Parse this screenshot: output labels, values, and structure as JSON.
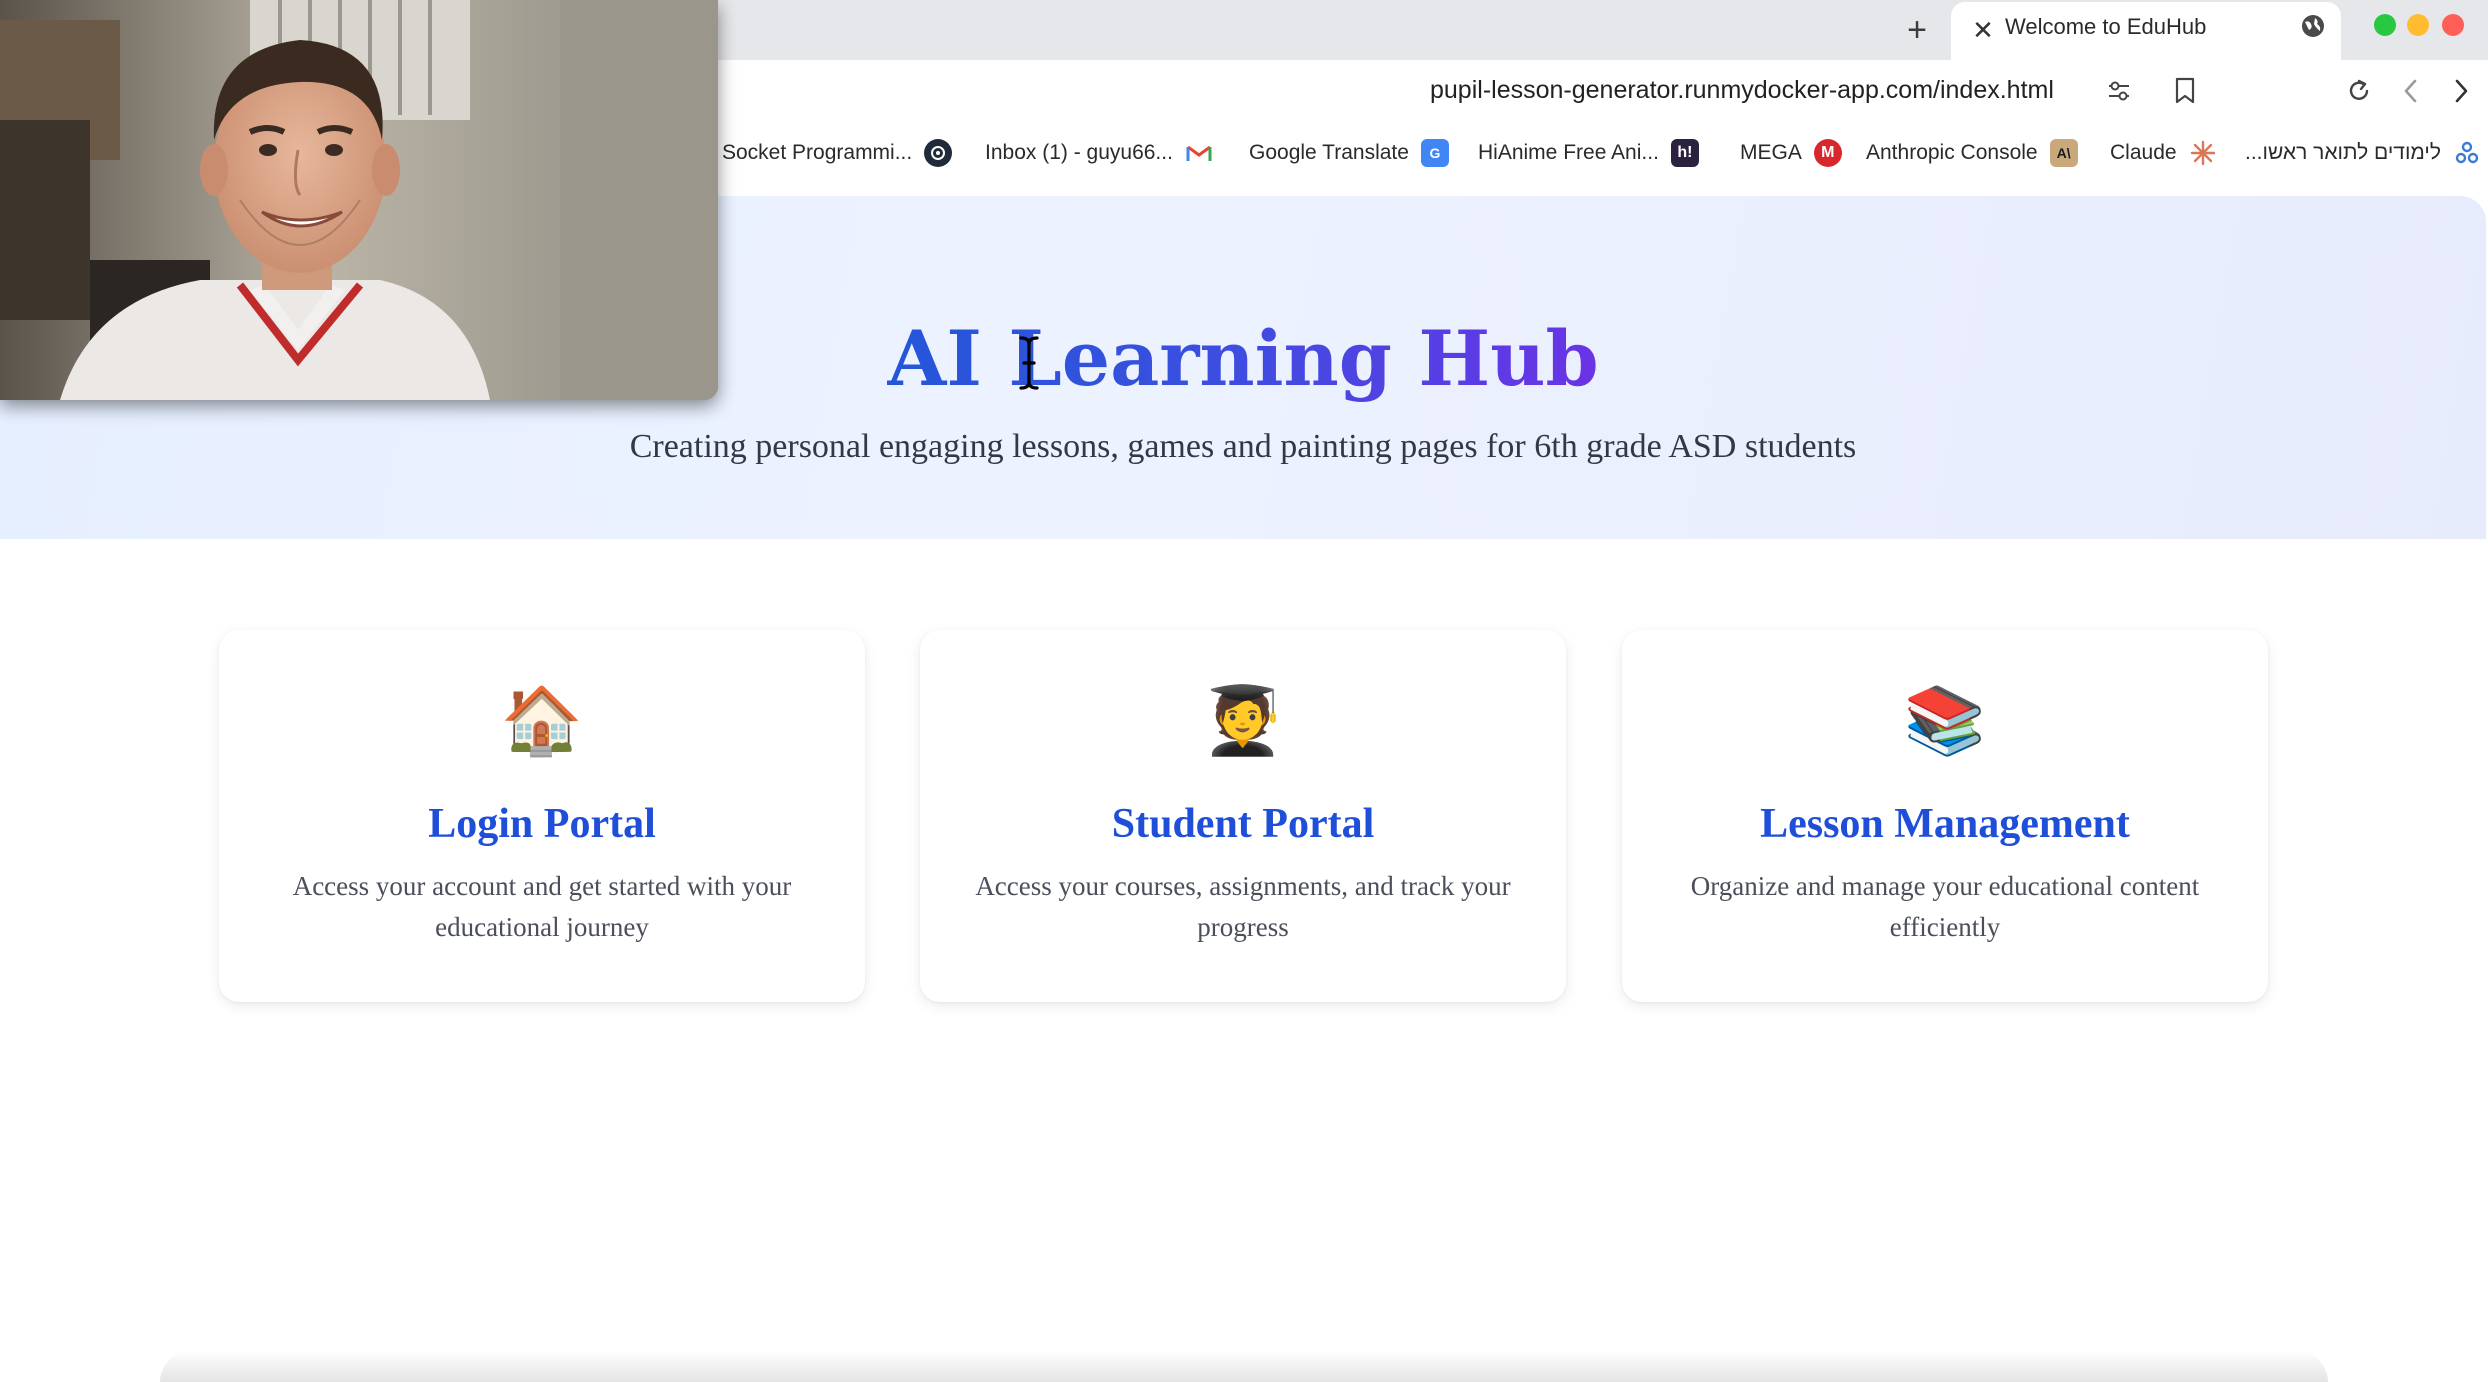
{
  "browser": {
    "tab_title": "Welcome to EduHub",
    "new_tab_label": "+",
    "tab_close_label": "✕",
    "url": "pupil-lesson-generator.runmydocker-app.com/index.html",
    "bookmarks": [
      {
        "label": "Socket Programmi...",
        "icon": "socket-icon"
      },
      {
        "label": "Inbox (1) - guyu66...",
        "icon": "gmail-icon"
      },
      {
        "label": "Google Translate",
        "icon": "google-translate-icon"
      },
      {
        "label": "HiAnime Free Ani...",
        "icon": "hianime-icon",
        "icon_text": "h!"
      },
      {
        "label": "MEGA",
        "icon": "mega-icon",
        "icon_text": "M"
      },
      {
        "label": "Anthropic Console",
        "icon": "anthropic-icon",
        "icon_text": "A\\"
      },
      {
        "label": "Claude",
        "icon": "claude-icon"
      },
      {
        "label": "...לימודים לתואר ראשו",
        "icon": "folder-icon"
      }
    ]
  },
  "hero": {
    "title": "AI Learning Hub",
    "subtitle": "Creating personal engaging lessons, games and painting pages for 6th grade ASD students"
  },
  "cards": [
    {
      "emoji": "🏠",
      "title": "Login Portal",
      "description": "Access your account and get started with your educational journey"
    },
    {
      "emoji": "🧑‍🎓",
      "title": "Student Portal",
      "description": "Access your courses, assignments, and track your progress"
    },
    {
      "emoji": "📚",
      "title": "Lesson Management",
      "description": "Organize and manage your educational content efficiently"
    }
  ],
  "colors": {
    "title_gradient_start": "#2456d8",
    "title_gradient_end": "#6a33e6",
    "card_title": "#1f4fd8",
    "hero_background": "#e8efff"
  }
}
